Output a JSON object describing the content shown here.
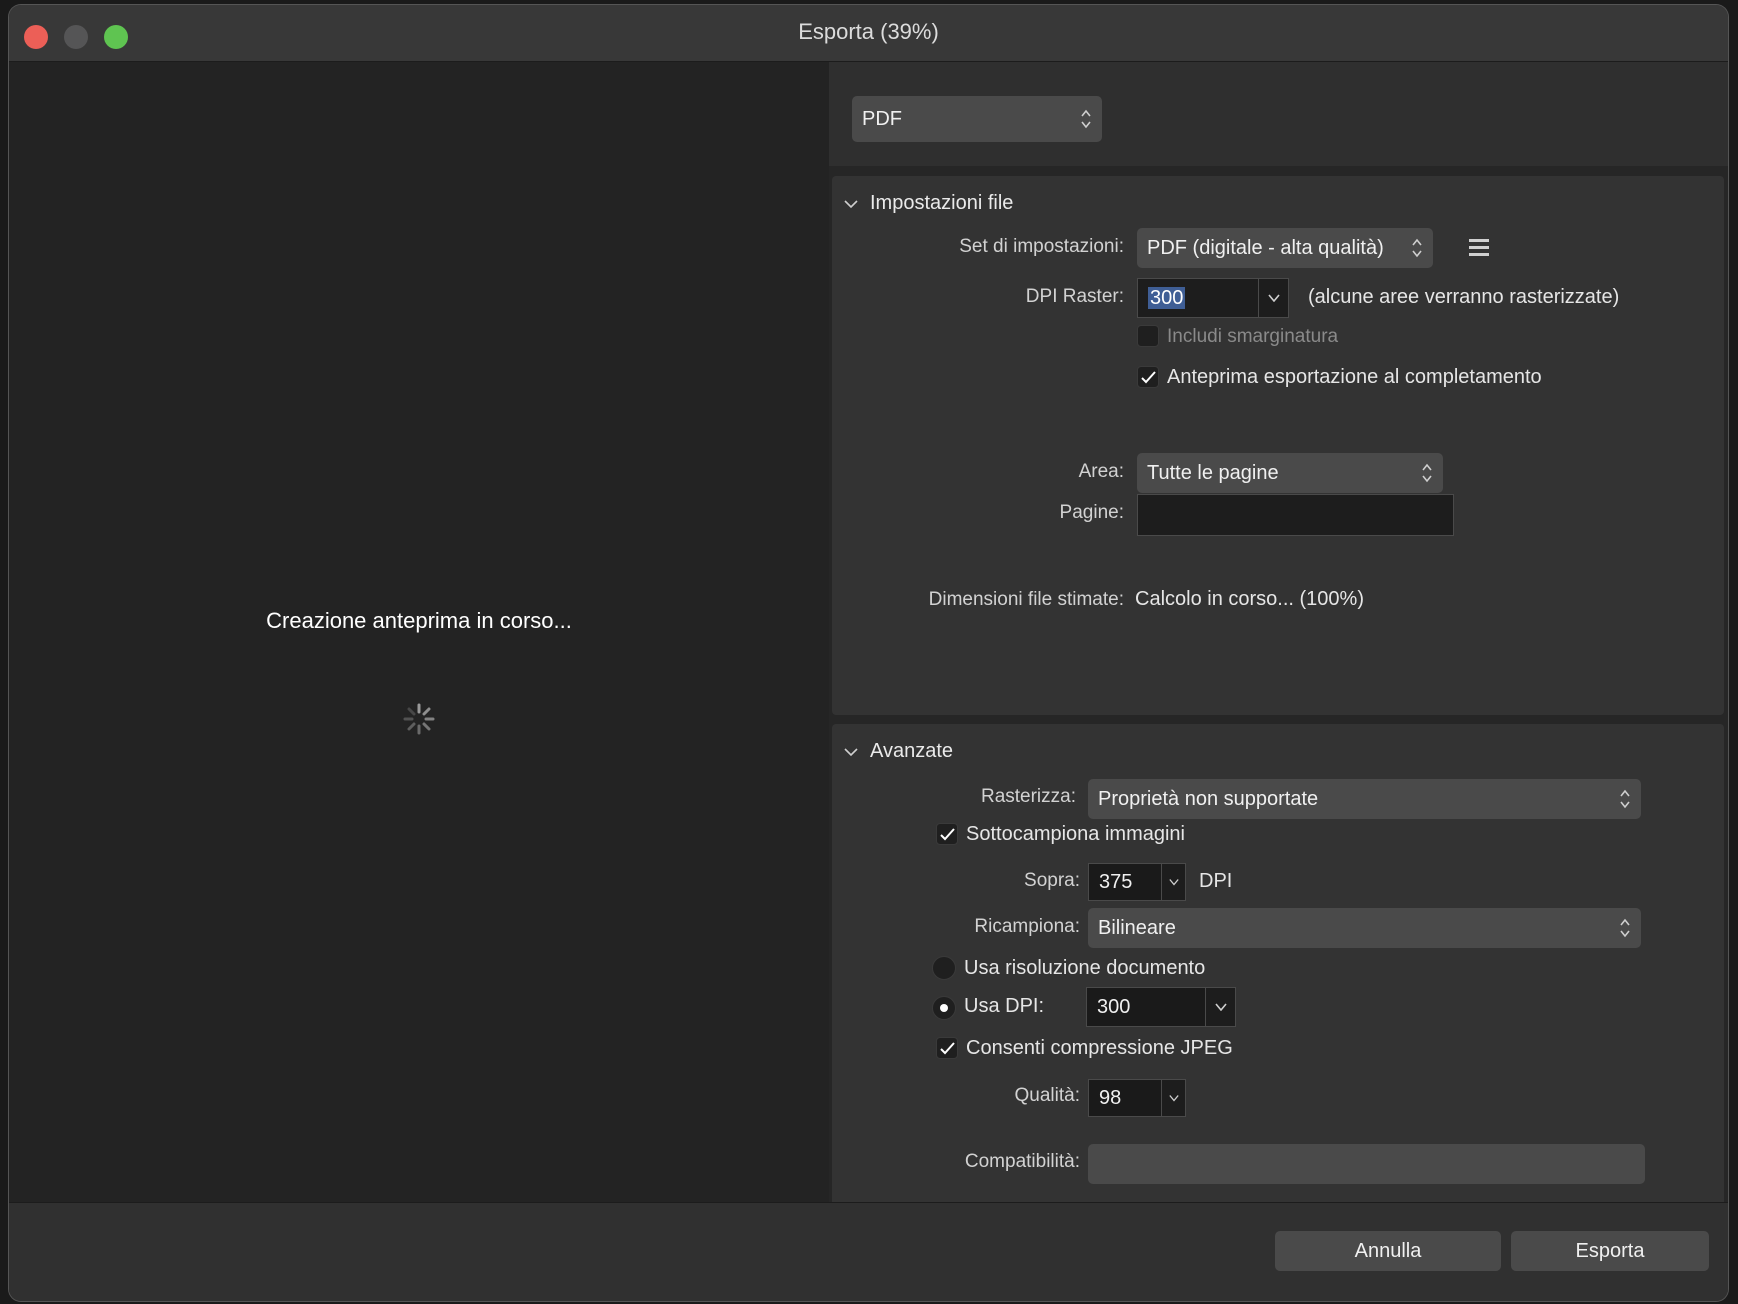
{
  "window": {
    "title": "Esporta (39%)"
  },
  "preview": {
    "message": "Creazione anteprima in corso..."
  },
  "format": {
    "selected": "PDF"
  },
  "file_settings": {
    "header": "Impostazioni file",
    "preset_label": "Set di impostazioni:",
    "preset_value": "PDF (digitale - alta qualità)",
    "dpi_label": "DPI Raster:",
    "dpi_value": "300",
    "dpi_note": "(alcune aree verranno rasterizzate)",
    "bleed_label": "Includi smarginatura",
    "bleed_checked": false,
    "preview_label": "Anteprima esportazione al completamento",
    "preview_checked": true,
    "area_label": "Area:",
    "area_value": "Tutte le pagine",
    "pages_label": "Pagine:",
    "pages_value": "",
    "size_label": "Dimensioni file stimate:",
    "size_value": "Calcolo in corso... (100%)"
  },
  "advanced": {
    "header": "Avanzate",
    "rasterize_label": "Rasterizza:",
    "rasterize_value": "Proprietà non supportate",
    "downsample_label": "Sottocampiona immagini",
    "downsample_checked": true,
    "above_label": "Sopra:",
    "above_value": "375",
    "above_unit": "DPI",
    "resample_label": "Ricampiona:",
    "resample_value": "Bilineare",
    "use_doc_res_label": "Usa risoluzione documento",
    "use_dpi_label": "Usa DPI:",
    "use_dpi_value": "300",
    "use_dpi_selected": true,
    "jpeg_label": "Consenti compressione JPEG",
    "jpeg_checked": true,
    "quality_label": "Qualità:",
    "quality_value": "98",
    "compat_label": "Compatibilità:"
  },
  "footer": {
    "cancel": "Annulla",
    "export": "Esporta"
  },
  "colors": {
    "close": "#ec5f57",
    "zoom": "#5fc451",
    "selection": "#3f5e95"
  }
}
